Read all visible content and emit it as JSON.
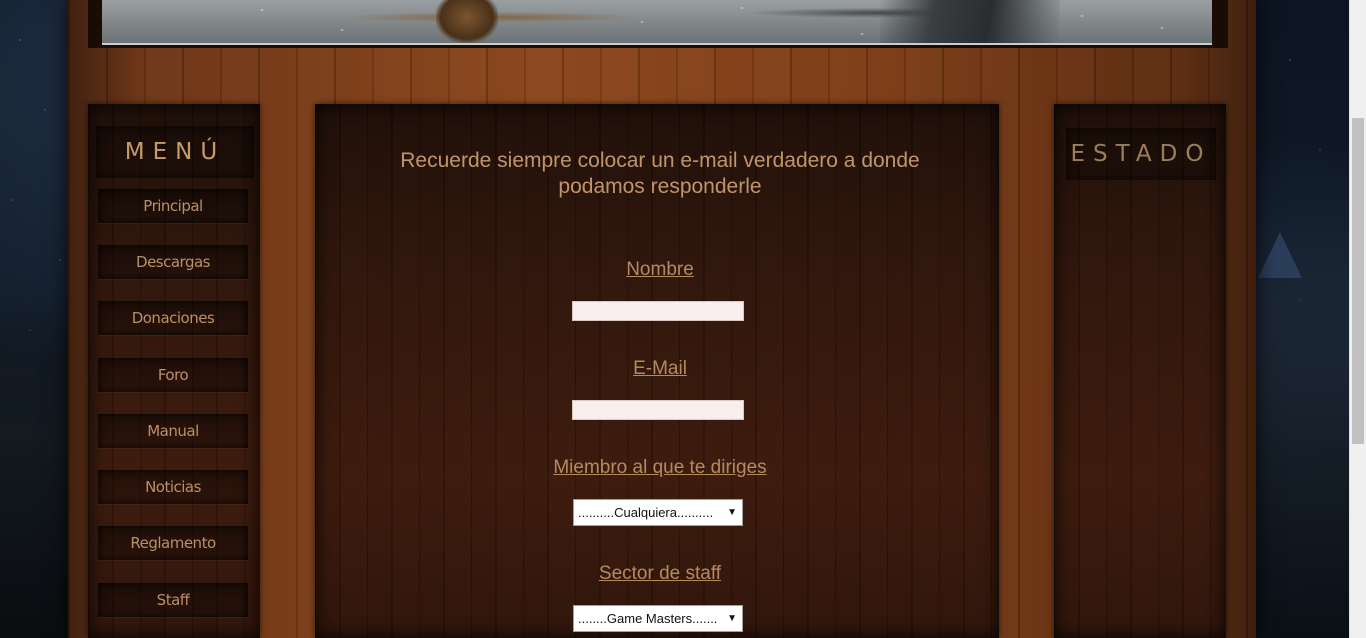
{
  "menu": {
    "heading": "MENÚ",
    "items": [
      {
        "label": "Principal"
      },
      {
        "label": "Descargas"
      },
      {
        "label": "Donaciones"
      },
      {
        "label": "Foro"
      },
      {
        "label": "Manual"
      },
      {
        "label": "Noticias"
      },
      {
        "label": "Reglamento"
      },
      {
        "label": "Staff"
      }
    ]
  },
  "status": {
    "heading": "ESTADO"
  },
  "form": {
    "intro": "Recuerde siempre colocar un e-mail verdadero a donde podamos responderle",
    "name_label": "Nombre",
    "name_value": "",
    "email_label": "E-Mail",
    "email_value": "",
    "member_label": "Miembro al que te diriges",
    "member_selected": "..........Cualquiera..........",
    "sector_label": "Sector de staff",
    "sector_selected": "........Game Masters.......",
    "dropdown_arrow": "▼"
  },
  "colors": {
    "heading_text": "#c69a6a",
    "menu_text": "#bc8f64",
    "label_text": "#b58a5f",
    "input_background": "#f8eeee"
  }
}
